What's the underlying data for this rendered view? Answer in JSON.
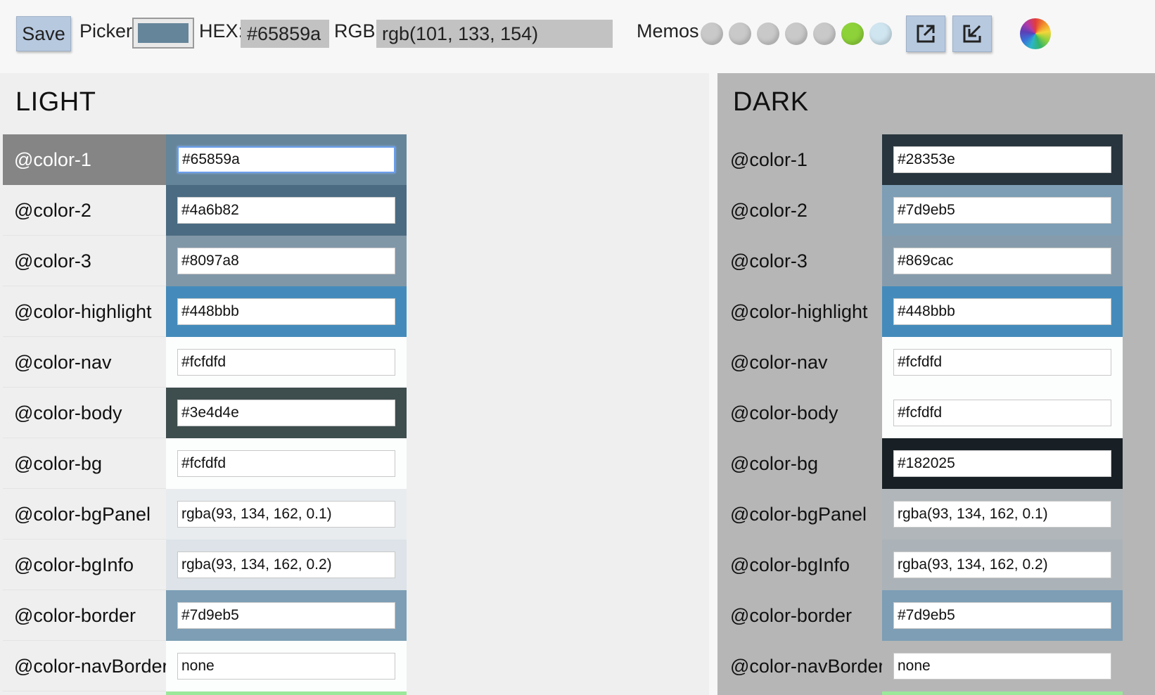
{
  "toolbar": {
    "save_label": "Save",
    "picker_label": "Picker",
    "picker_color": "#65859a",
    "hex_label": "HEX:",
    "hex_value": "#65859a",
    "rgb_label": "RGB:",
    "rgb_value": "rgb(101, 133, 154)",
    "memos_label": "Memos",
    "memos": [
      "#c9c9c9",
      "#c9c9c9",
      "#c9c9c9",
      "#c9c9c9",
      "#c9c9c9",
      "#8ed23a",
      "#cfe5ef"
    ],
    "export_icon": "export-icon",
    "import_icon": "import-icon",
    "wheel_icon": "color-wheel-icon"
  },
  "light": {
    "title": "LIGHT",
    "rows": [
      {
        "name": "@color-1",
        "value": "#65859a",
        "swatch": "#65859a",
        "active": true
      },
      {
        "name": "@color-2",
        "value": "#4a6b82",
        "swatch": "#4a6b82"
      },
      {
        "name": "@color-3",
        "value": "#8097a8",
        "swatch": "#8097a8"
      },
      {
        "name": "@color-highlight",
        "value": "#448bbb",
        "swatch": "#448bbb"
      },
      {
        "name": "@color-nav",
        "value": "#fcfdfd",
        "swatch": "#fcfdfd"
      },
      {
        "name": "@color-body",
        "value": "#3e4d4e",
        "swatch": "#3e4d4e"
      },
      {
        "name": "@color-bg",
        "value": "#fcfdfd",
        "swatch": "#fcfdfd"
      },
      {
        "name": "@color-bgPanel",
        "value": "rgba(93, 134, 162, 0.1)",
        "swatch": "#e8ecef"
      },
      {
        "name": "@color-bgInfo",
        "value": "rgba(93, 134, 162, 0.2)",
        "swatch": "#dde3e8"
      },
      {
        "name": "@color-border",
        "value": "#7d9eb5",
        "swatch": "#7d9eb5"
      },
      {
        "name": "@color-navBorder",
        "value": "none",
        "swatch": "#fcfdfd"
      }
    ],
    "partial_row_swatch": "#9be89a"
  },
  "dark": {
    "title": "DARK",
    "rows": [
      {
        "name": "@color-1",
        "value": "#28353e",
        "swatch": "#28353e"
      },
      {
        "name": "@color-2",
        "value": "#7d9eb5",
        "swatch": "#7d9eb5"
      },
      {
        "name": "@color-3",
        "value": "#869cac",
        "swatch": "#869cac"
      },
      {
        "name": "@color-highlight",
        "value": "#448bbb",
        "swatch": "#448bbb"
      },
      {
        "name": "@color-nav",
        "value": "#fcfdfd",
        "swatch": "#fcfdfd"
      },
      {
        "name": "@color-body",
        "value": "#fcfdfd",
        "swatch": "#fcfdfd"
      },
      {
        "name": "@color-bg",
        "value": "#182025",
        "swatch": "#182025"
      },
      {
        "name": "@color-bgPanel",
        "value": "rgba(93, 134, 162, 0.1)",
        "swatch": "#b0b6ba"
      },
      {
        "name": "@color-bgInfo",
        "value": "rgba(93, 134, 162, 0.2)",
        "swatch": "#abb3b8"
      },
      {
        "name": "@color-border",
        "value": "#7d9eb5",
        "swatch": "#7d9eb5"
      },
      {
        "name": "@color-navBorder",
        "value": "none",
        "swatch": "#b6b6b6"
      }
    ],
    "partial_row_swatch": "#9be89a"
  }
}
